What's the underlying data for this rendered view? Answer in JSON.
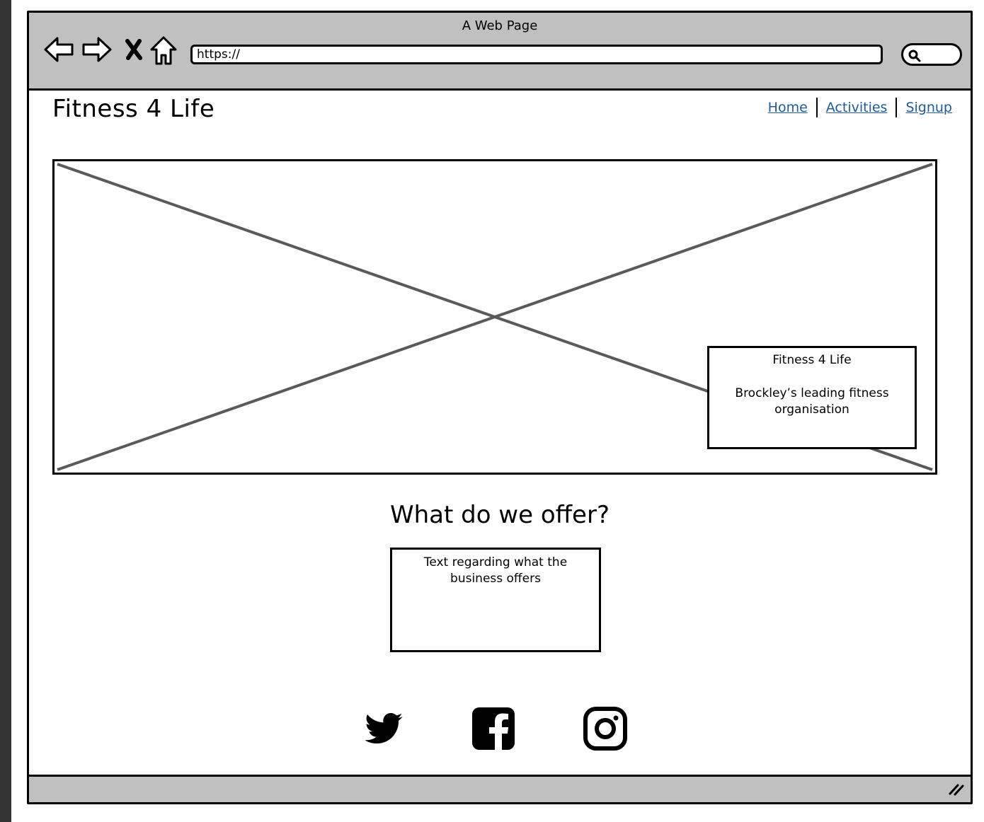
{
  "browser": {
    "title": "A Web Page",
    "url": "https://",
    "icons": [
      "back-arrow-icon",
      "forward-arrow-icon",
      "close-x-icon",
      "home-icon",
      "search-icon",
      "resize-grip-icon"
    ]
  },
  "header": {
    "site_title": "Fitness 4 Life",
    "nav": [
      {
        "label": "Home"
      },
      {
        "label": "Activities"
      },
      {
        "label": "Signup"
      }
    ],
    "link_color": "#1f5aa0"
  },
  "hero": {
    "image_placeholder": "image-placeholder",
    "caption_title": "Fitness 4 Life",
    "caption_text": "Brockley’s leading fitness organisation"
  },
  "offer": {
    "heading": "What do we offer?",
    "text": "Text regarding what the business offers"
  },
  "social": [
    {
      "icon": "twitter-icon"
    },
    {
      "icon": "facebook-icon"
    },
    {
      "icon": "instagram-icon"
    }
  ],
  "colors": {
    "chrome": "#c0c0c0",
    "border": "#000000",
    "placeholder_lines": "#5a5a5a"
  }
}
